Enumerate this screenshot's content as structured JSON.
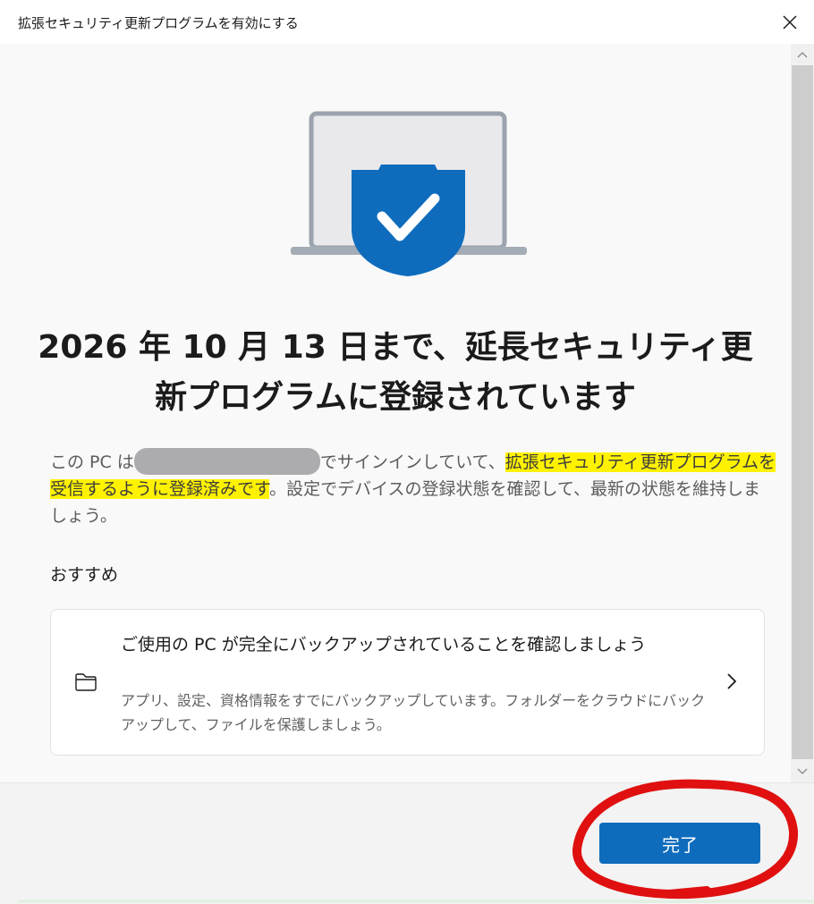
{
  "window": {
    "title": "拡張セキュリティ更新プログラムを有効にする"
  },
  "heading": "2026 年 10 月 13 日まで、延長セキュリティ更新プログラムに登録されています",
  "description": {
    "part1": "この PC は",
    "part2": "でサインインしていて、",
    "highlight": "拡張セキュリティ更新プログラムを受信するように登録済みです",
    "part3": "。設定でデバイスの登録状態を確認して、最新の状態を維持しましょう。"
  },
  "recommendations": {
    "heading": "おすすめ",
    "card": {
      "title": "ご使用の PC が完全にバックアップされていることを確認しましょう",
      "description": "アプリ、設定、資格情報をすでにバックアップしています。フォルダーをクラウドにバックアップして、ファイルを保護しましょう。",
      "icon": "folder-icon"
    }
  },
  "footer": {
    "done_label": "完了"
  },
  "colors": {
    "accent": "#0f6cbd",
    "highlight": "#fff200",
    "annotation_red": "#e01010",
    "shield": "#0f6cbd"
  }
}
